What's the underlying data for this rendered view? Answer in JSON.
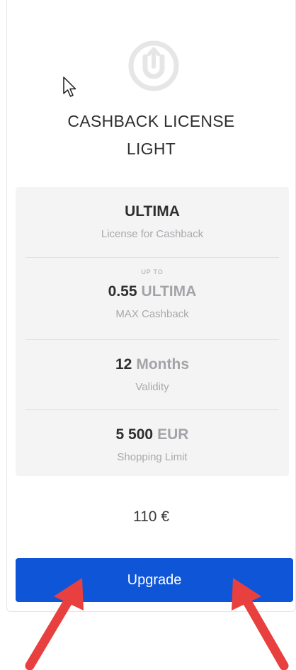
{
  "license": {
    "title_line1": "CASHBACK LICENSE",
    "title_line2": "LIGHT",
    "logo_icon": "ultima-u-logo-icon"
  },
  "features": [
    {
      "pre_label": "",
      "value": "ULTIMA",
      "unit": "",
      "caption": "License for Cashback"
    },
    {
      "pre_label": "UP TO",
      "value": "0.55",
      "unit": "ULTIMA",
      "caption": "MAX Cashback"
    },
    {
      "pre_label": "",
      "value": "12",
      "unit": "Months",
      "caption": "Validity"
    },
    {
      "pre_label": "",
      "value": "5 500",
      "unit": "EUR",
      "caption": "Shopping Limit"
    }
  ],
  "price": "110 €",
  "actions": {
    "upgrade_label": "Upgrade"
  },
  "colors": {
    "button": "#0f55d8",
    "arrows": "#e8403f",
    "panel": "#f4f4f5"
  }
}
